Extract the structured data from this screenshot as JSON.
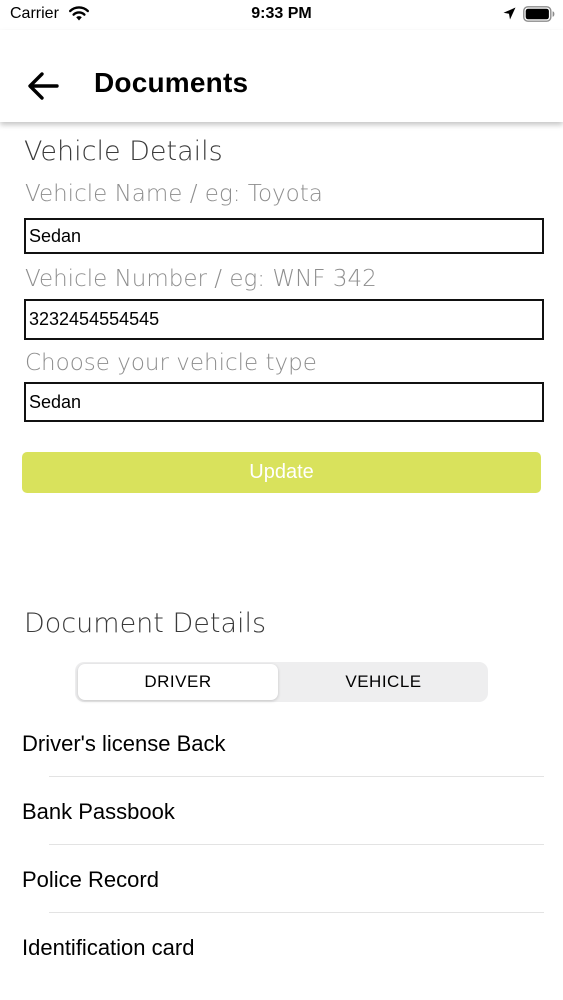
{
  "status_bar": {
    "carrier": "Carrier",
    "time": "9:33 PM",
    "icons": [
      "wifi-icon",
      "location-arrow-icon",
      "battery-icon"
    ]
  },
  "nav": {
    "back_icon": "arrow-left-icon",
    "title": "Documents"
  },
  "vehicle_details": {
    "title": "Vehicle Details",
    "fields": [
      {
        "label": "Vehicle Name / eg: Toyota",
        "value": "Sedan"
      },
      {
        "label": "Vehicle Number / eg: WNF 342",
        "value": "3232454554545"
      },
      {
        "label": "Choose your vehicle type",
        "value": "Sedan"
      }
    ],
    "update_label": "Update"
  },
  "document_details": {
    "title": "Document Details",
    "tabs": [
      {
        "label": "DRIVER",
        "selected": true
      },
      {
        "label": "VEHICLE",
        "selected": false
      }
    ],
    "items": [
      {
        "label": "Driver's license Back"
      },
      {
        "label": "Bank Passbook"
      },
      {
        "label": "Police Record"
      },
      {
        "label": "Identification card"
      }
    ]
  },
  "colors": {
    "accent": "#d9e25c",
    "label_gray": "#8e8e8e",
    "segment_bg": "#eeeeef"
  }
}
